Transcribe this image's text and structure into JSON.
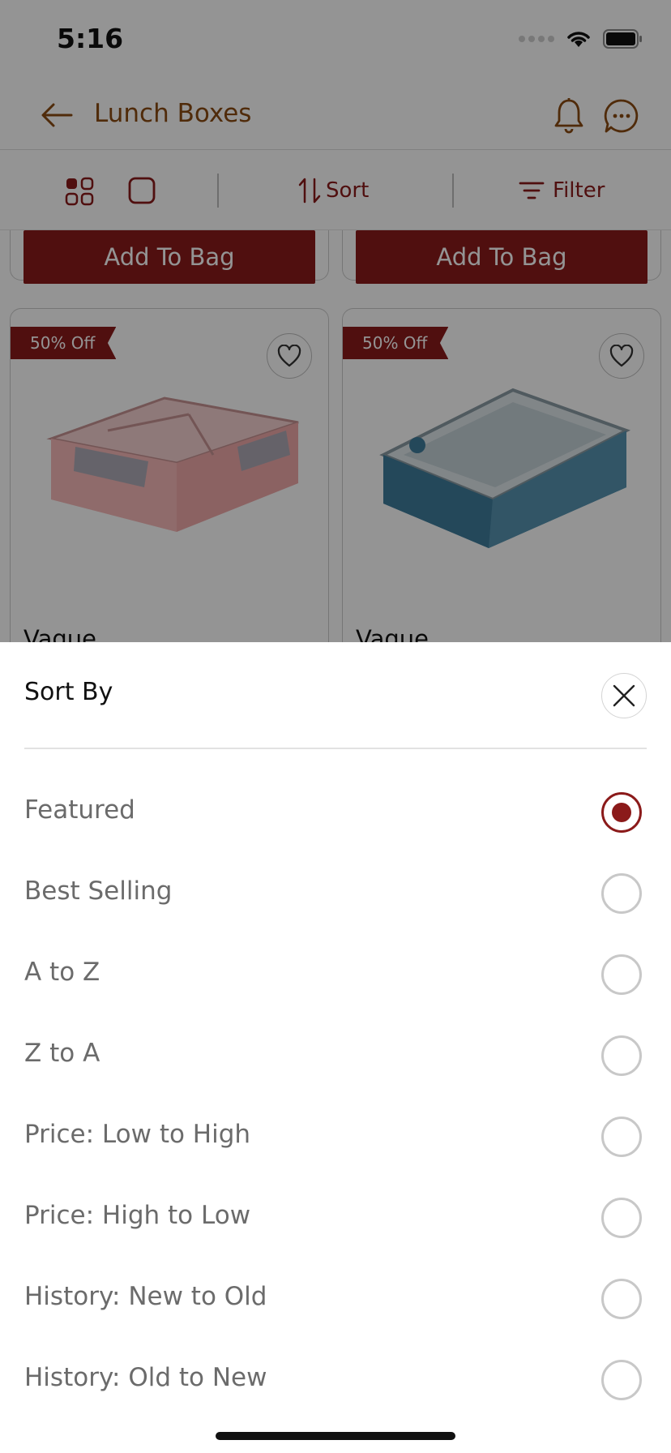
{
  "status_bar": {
    "time": "5:16"
  },
  "header": {
    "title": "Lunch Boxes"
  },
  "toolbar": {
    "sort_label": "Sort",
    "filter_label": "Filter"
  },
  "product_grid": {
    "add_to_bag_label": "Add To Bag",
    "products": [
      {
        "discount": "50% Off",
        "name": "Vague"
      },
      {
        "discount": "50% Off",
        "name": "Vague"
      }
    ]
  },
  "sort_sheet": {
    "title": "Sort By",
    "selected_index": 0,
    "options": [
      {
        "label": "Featured"
      },
      {
        "label": "Best Selling"
      },
      {
        "label": "A to Z"
      },
      {
        "label": "Z to A"
      },
      {
        "label": "Price: Low to High"
      },
      {
        "label": "Price: High to Low"
      },
      {
        "label": "History: New to Old"
      },
      {
        "label": "History: Old to New"
      }
    ]
  },
  "colors": {
    "accent": "#8b1a1a",
    "title_brown": "#8a4a12"
  },
  "icons": [
    "back-arrow-icon",
    "bell-icon",
    "chat-icon",
    "grid-view-icon",
    "single-view-icon",
    "sort-icon",
    "filter-icon",
    "heart-icon",
    "close-icon"
  ]
}
